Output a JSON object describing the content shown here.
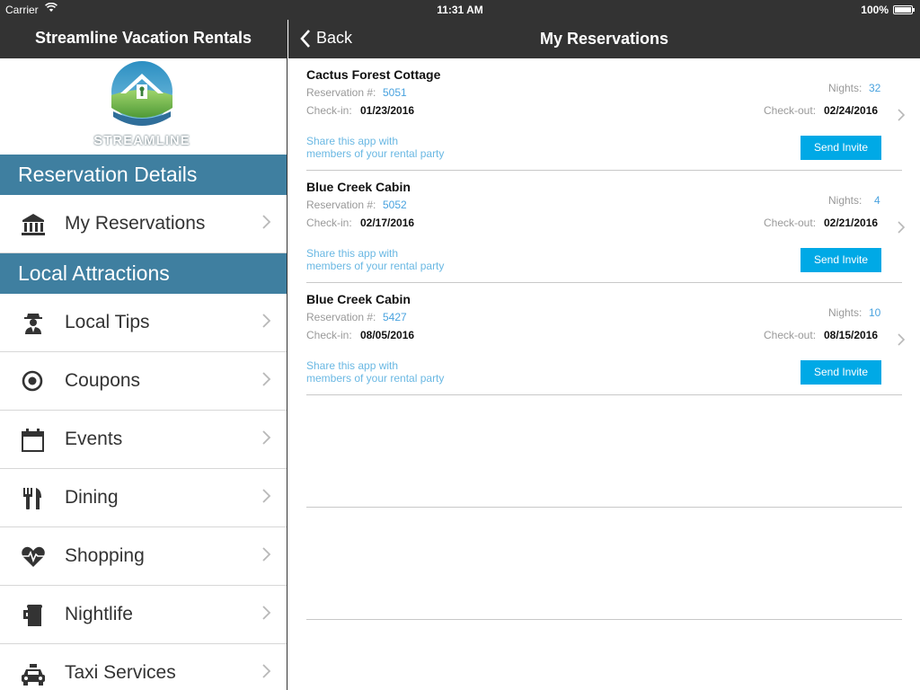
{
  "status_bar": {
    "carrier": "Carrier",
    "time": "11:31 AM",
    "battery": "100%"
  },
  "sidebar": {
    "title": "Streamline Vacation Rentals",
    "logo_text": "STREAMLINE",
    "sections": [
      {
        "title": "Reservation Details",
        "items": [
          {
            "label": "My Reservations",
            "icon": "bank-icon"
          }
        ]
      },
      {
        "title": "Local Attractions",
        "items": [
          {
            "label": "Local Tips",
            "icon": "spy-icon"
          },
          {
            "label": "Coupons",
            "icon": "target-icon"
          },
          {
            "label": "Events",
            "icon": "calendar-icon"
          },
          {
            "label": "Dining",
            "icon": "fork-knife-icon"
          },
          {
            "label": "Shopping",
            "icon": "heartbeat-icon"
          },
          {
            "label": "Nightlife",
            "icon": "beer-icon"
          },
          {
            "label": "Taxi Services",
            "icon": "taxi-icon"
          }
        ]
      }
    ]
  },
  "main": {
    "back_label": "Back",
    "title": "My Reservations",
    "labels": {
      "reservation": "Reservation #:",
      "check_in": "Check-in:",
      "check_out": "Check-out:",
      "nights": "Nights:",
      "share_line1": "Share this app with",
      "share_line2": "members of your rental party",
      "invite": "Send Invite"
    },
    "reservations": [
      {
        "name": "Cactus Forest Cottage",
        "number": "5051",
        "check_in": "01/23/2016",
        "check_out": "02/24/2016",
        "nights": "32"
      },
      {
        "name": "Blue Creek Cabin",
        "number": "5052",
        "check_in": "02/17/2016",
        "check_out": "02/21/2016",
        "nights": "4"
      },
      {
        "name": "Blue Creek Cabin",
        "number": "5427",
        "check_in": "08/05/2016",
        "check_out": "08/15/2016",
        "nights": "10"
      }
    ]
  },
  "colors": {
    "header_bg": "#333333",
    "section_bg": "#3f7fa0",
    "accent_blue": "#00a9e6",
    "link_blue": "#4aa3df"
  }
}
